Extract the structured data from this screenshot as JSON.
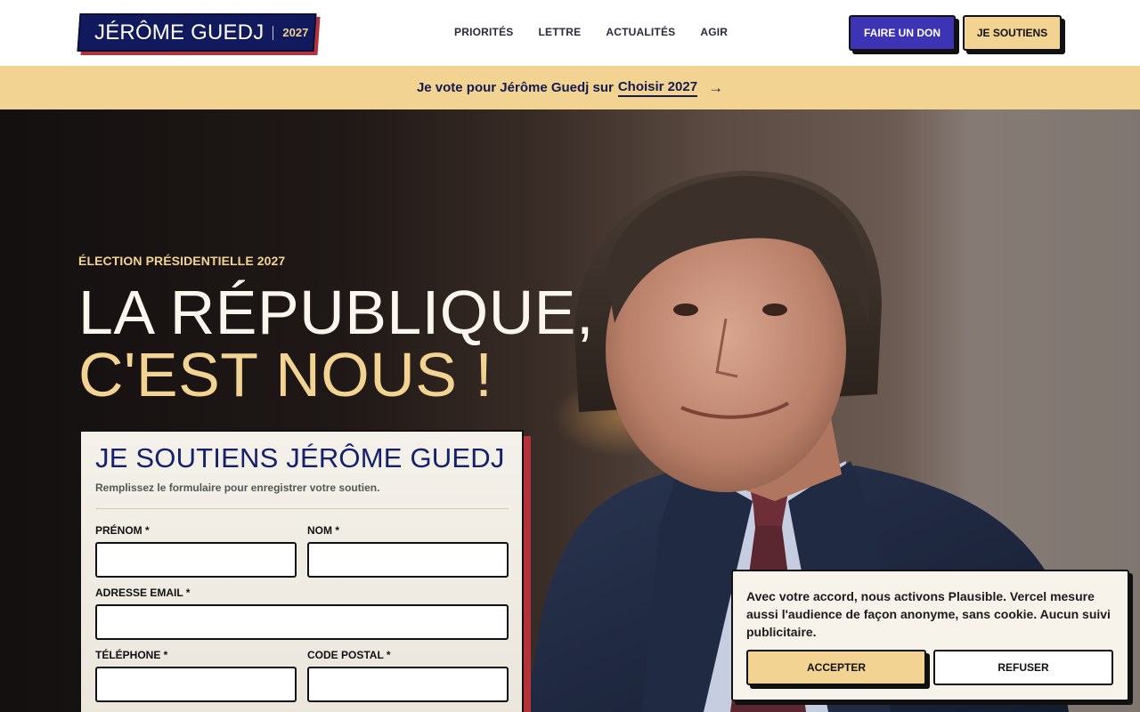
{
  "header": {
    "logo_name": "JÉRÔME GUEDJ",
    "logo_year": "2027",
    "nav": [
      "PRIORITÉS",
      "LETTRE",
      "ACTUALITÉS",
      "AGIR"
    ],
    "donate_label": "FAIRE UN DON",
    "support_label": "JE SOUTIENS"
  },
  "banner": {
    "text": "Je vote pour Jérôme Guedj sur",
    "link": "Choisir 2027",
    "arrow": "→"
  },
  "hero": {
    "eyebrow": "ÉLECTION PRÉSIDENTIELLE 2027",
    "title_line1": "LA RÉPUBLIQUE,",
    "title_line2": "C'EST NOUS !"
  },
  "form": {
    "title": "JE SOUTIENS JÉRÔME GUEDJ",
    "subtitle": "Remplissez le formulaire pour enregistrer votre soutien.",
    "first_name_label": "PRÉNOM *",
    "last_name_label": "NOM *",
    "email_label": "ADRESSE EMAIL *",
    "phone_label": "TÉLÉPHONE *",
    "postal_label": "CODE POSTAL *"
  },
  "cookie": {
    "text": "Avec votre accord, nous activons Plausible. Vercel mesure aussi l'audience de façon anonyme, sans cookie. Aucun suivi publicitaire.",
    "accept_label": "ACCEPTER",
    "refuse_label": "REFUSER"
  },
  "colors": {
    "navy": "#111a5c",
    "gold": "#f2d392",
    "red": "#b3333a",
    "violet": "#3c33b5"
  }
}
